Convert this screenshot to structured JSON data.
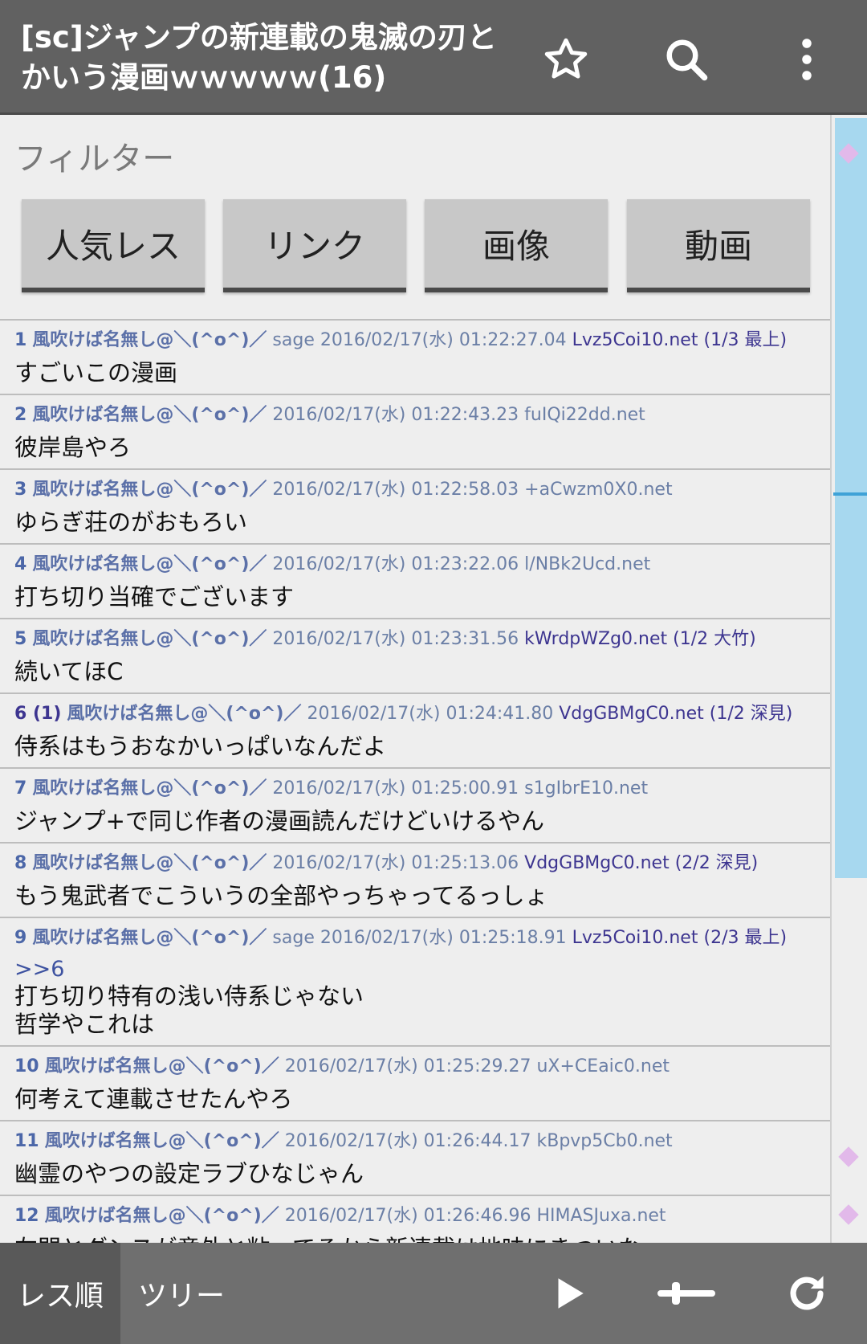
{
  "header": {
    "title": "[sc]ジャンプの新連載の鬼滅の刃と\nかいう漫画ｗｗｗｗｗ(16)",
    "icons": [
      "star-outline-icon",
      "search-icon",
      "more-vert-icon"
    ]
  },
  "filter": {
    "label": "フィルター",
    "buttons": [
      "人気レス",
      "リンク",
      "画像",
      "動画"
    ]
  },
  "posts": [
    {
      "num": "1",
      "name": "風吹けば名無し@＼(^o^)／",
      "mail": "sage",
      "date": "2016/02/17(水) 01:22:27.04",
      "id": "Lvz5Coi10.net",
      "idcount": "(1/3 最上)",
      "body": "すごいこの漫画"
    },
    {
      "num": "2",
      "name": "風吹けば名無し@＼(^o^)／",
      "mail": "",
      "date": "2016/02/17(水) 01:22:43.23",
      "id": "fuIQi22dd.net",
      "idcount": "",
      "body": "彼岸島やろ"
    },
    {
      "num": "3",
      "name": "風吹けば名無し@＼(^o^)／",
      "mail": "",
      "date": "2016/02/17(水) 01:22:58.03",
      "id": "+aCwzm0X0.net",
      "idcount": "",
      "body": "ゆらぎ荘のがおもろい"
    },
    {
      "num": "4",
      "name": "風吹けば名無し@＼(^o^)／",
      "mail": "",
      "date": "2016/02/17(水) 01:23:22.06",
      "id": "l/NBk2Ucd.net",
      "idcount": "",
      "body": "打ち切り当確でございます"
    },
    {
      "num": "5",
      "name": "風吹けば名無し@＼(^o^)／",
      "mail": "",
      "date": "2016/02/17(水) 01:23:31.56",
      "id": "kWrdpWZg0.net",
      "idcount": "(1/2 大竹)",
      "body": "続いてほC"
    },
    {
      "num": "6 (1)",
      "name": "風吹けば名無し@＼(^o^)／",
      "mail": "",
      "date": "2016/02/17(水) 01:24:41.80",
      "id": "VdgGBMgC0.net",
      "idcount": "(1/2 深見)",
      "body": "侍系はもうおなかいっぱいなんだよ"
    },
    {
      "num": "7",
      "name": "風吹けば名無し@＼(^o^)／",
      "mail": "",
      "date": "2016/02/17(水) 01:25:00.91",
      "id": "s1gIbrE10.net",
      "idcount": "",
      "body": "ジャンプ+で同じ作者の漫画読んだけどいけるやん"
    },
    {
      "num": "8",
      "name": "風吹けば名無し@＼(^o^)／",
      "mail": "",
      "date": "2016/02/17(水) 01:25:13.06",
      "id": "VdgGBMgC0.net",
      "idcount": "(2/2 深見)",
      "body": "もう鬼武者でこういうの全部やっちゃってるっしょ"
    },
    {
      "num": "9",
      "name": "風吹けば名無し@＼(^o^)／",
      "mail": "sage",
      "date": "2016/02/17(水) 01:25:18.91",
      "id": "Lvz5Coi10.net",
      "idcount": "(2/3 最上)",
      "anchor": ">>6",
      "body": "打ち切り特有の浅い侍系じゃない\n哲学やこれは"
    },
    {
      "num": "10",
      "name": "風吹けば名無し@＼(^o^)／",
      "mail": "",
      "date": "2016/02/17(水) 01:25:29.27",
      "id": "uX+CEaic0.net",
      "idcount": "",
      "body": "何考えて連載させたんやろ"
    },
    {
      "num": "11",
      "name": "風吹けば名無し@＼(^o^)／",
      "mail": "",
      "date": "2016/02/17(水) 01:26:44.17",
      "id": "kBpvp5Cb0.net",
      "idcount": "",
      "body": "幽霊のやつの設定ラブひなじゃん"
    },
    {
      "num": "12",
      "name": "風吹けば名無し@＼(^o^)／",
      "mail": "",
      "date": "2016/02/17(水) 01:26:46.96",
      "id": "HIMASJuxa.net",
      "idcount": "",
      "body": "左門とダンスが意外と粘ってるから新連載は地味にきついな"
    }
  ],
  "bottom": {
    "tabs": [
      "レス順",
      "ツリー"
    ],
    "icons": [
      "play-icon",
      "slider-icon",
      "refresh-icon"
    ]
  },
  "colors": {
    "appbar": "#616161",
    "meta": "#6b7fa6",
    "multi_id": "#3d3590",
    "scroll_thumb": "#a7d8ef",
    "marker": "#e2b9ea"
  }
}
